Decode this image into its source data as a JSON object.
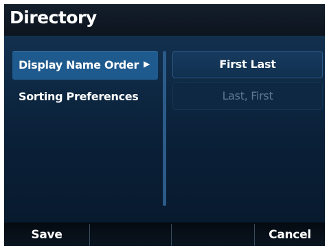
{
  "header": {
    "title": "Directory"
  },
  "menu": {
    "items": [
      {
        "label": "Display Name Order",
        "selected": true,
        "arrow": "▶"
      },
      {
        "label": "Sorting Preferences",
        "selected": false
      }
    ]
  },
  "options": [
    {
      "label": "First Last",
      "selected": true
    },
    {
      "label": "Last, First",
      "selected": false
    }
  ],
  "softkeys": [
    {
      "label": "Save"
    },
    {
      "label": ""
    },
    {
      "label": ""
    },
    {
      "label": "Cancel"
    }
  ],
  "colors": {
    "background": "#0a1e33",
    "selected_item": "#1f5a8e",
    "divider": "#2b5b89",
    "dim_text": "#5c7893"
  }
}
